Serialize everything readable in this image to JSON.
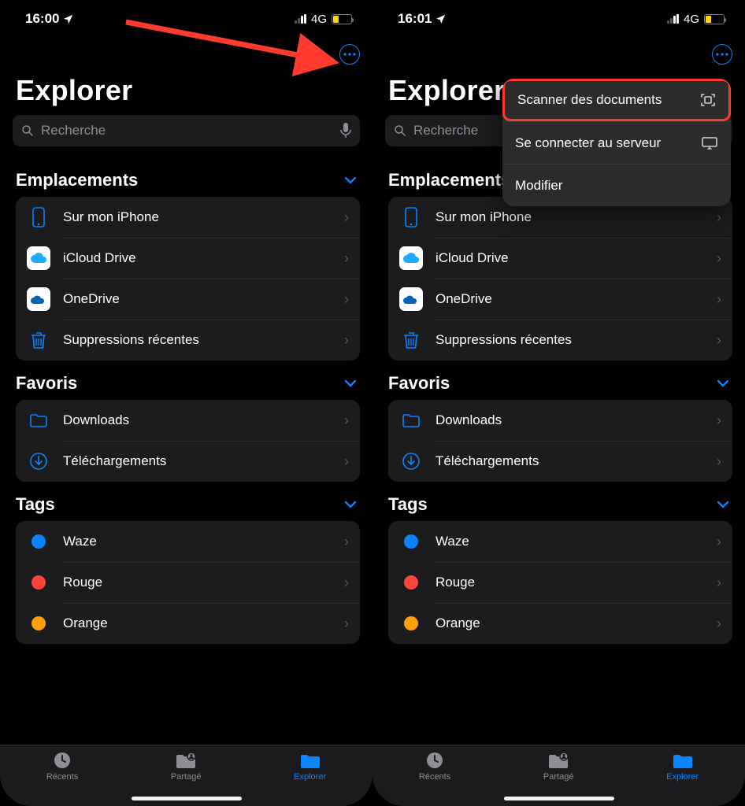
{
  "screens": {
    "left": {
      "time": "16:00",
      "network": "4G"
    },
    "right": {
      "time": "16:01",
      "network": "4G"
    }
  },
  "title": "Explorer",
  "search": {
    "placeholder": "Recherche"
  },
  "sections": {
    "locations": {
      "header": "Emplacements",
      "items": [
        {
          "label": "Sur mon iPhone"
        },
        {
          "label": "iCloud Drive"
        },
        {
          "label": "OneDrive"
        },
        {
          "label": "Suppressions récentes"
        }
      ]
    },
    "favorites": {
      "header": "Favoris",
      "items": [
        {
          "label": "Downloads"
        },
        {
          "label": "Téléchargements"
        }
      ]
    },
    "tags": {
      "header": "Tags",
      "items": [
        {
          "label": "Waze",
          "color": "#0a84ff"
        },
        {
          "label": "Rouge",
          "color": "#ff453a"
        },
        {
          "label": "Orange",
          "color": "#ff9f0a"
        }
      ]
    }
  },
  "tabs": [
    {
      "label": "Récents",
      "active": false
    },
    {
      "label": "Partagé",
      "active": false
    },
    {
      "label": "Explorer",
      "active": true
    }
  ],
  "popover": {
    "items": [
      {
        "label": "Scanner des documents",
        "highlight": true
      },
      {
        "label": "Se connecter au serveur",
        "highlight": false
      },
      {
        "label": "Modifier",
        "highlight": false
      }
    ]
  }
}
